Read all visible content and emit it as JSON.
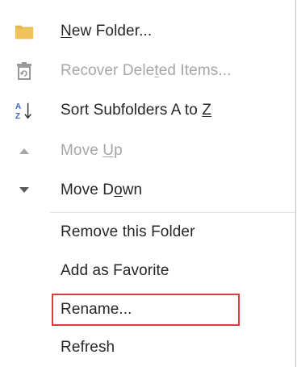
{
  "menu": {
    "items": [
      {
        "id": "new-folder",
        "pre": "",
        "acc": "N",
        "post": "ew Folder...",
        "enabled": true,
        "icon": "folder-icon"
      },
      {
        "id": "recover-deleted-items",
        "pre": "Recover Dele",
        "acc": "t",
        "post": "ed Items...",
        "enabled": false,
        "icon": "recover-deleted-icon"
      },
      {
        "id": "sort-subfolders",
        "pre": "Sort Subfolders A to ",
        "acc": "Z",
        "post": "",
        "enabled": true,
        "icon": "sort-a-z-icon"
      },
      {
        "id": "move-up",
        "pre": "Move ",
        "acc": "U",
        "post": "p",
        "enabled": false,
        "icon": "triangle-up-icon"
      },
      {
        "id": "move-down",
        "pre": "Move D",
        "acc": "o",
        "post": "wn",
        "enabled": true,
        "icon": "triangle-down-icon"
      },
      {
        "id": "remove-folder",
        "pre": "Remove this Folder",
        "acc": "",
        "post": "",
        "enabled": true,
        "icon": ""
      },
      {
        "id": "add-favorite",
        "pre": "Add as Favorite",
        "acc": "",
        "post": "",
        "enabled": true,
        "icon": ""
      },
      {
        "id": "rename",
        "pre": "Rename...",
        "acc": "",
        "post": "",
        "enabled": true,
        "icon": ""
      },
      {
        "id": "refresh",
        "pre": "Refresh",
        "acc": "",
        "post": "",
        "enabled": true,
        "icon": ""
      }
    ],
    "highlighted_item": "Rename...",
    "highlight_color": "#e0393e",
    "folder_color": "#e8b64c",
    "icon_gray": "#7f7f7f",
    "sort_blue": "#3a6bc4"
  }
}
